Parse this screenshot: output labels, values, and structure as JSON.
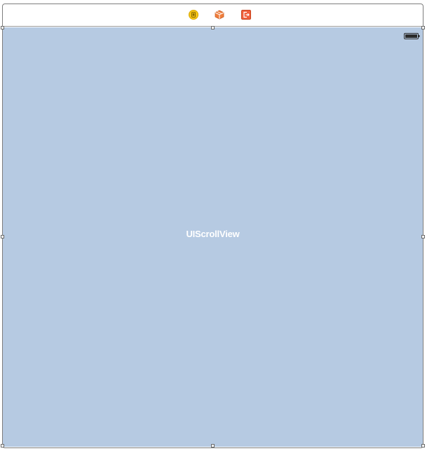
{
  "dock": {
    "icons": [
      {
        "name": "view-controller-icon",
        "color": "#f5c518"
      },
      {
        "name": "first-responder-icon",
        "color": "#f07e3c"
      },
      {
        "name": "exit-icon",
        "color": "#f0603c"
      }
    ]
  },
  "canvas": {
    "background": "#b6cae2",
    "label": "UIScrollView"
  },
  "status_bar": {
    "battery_icon": "battery-icon"
  }
}
